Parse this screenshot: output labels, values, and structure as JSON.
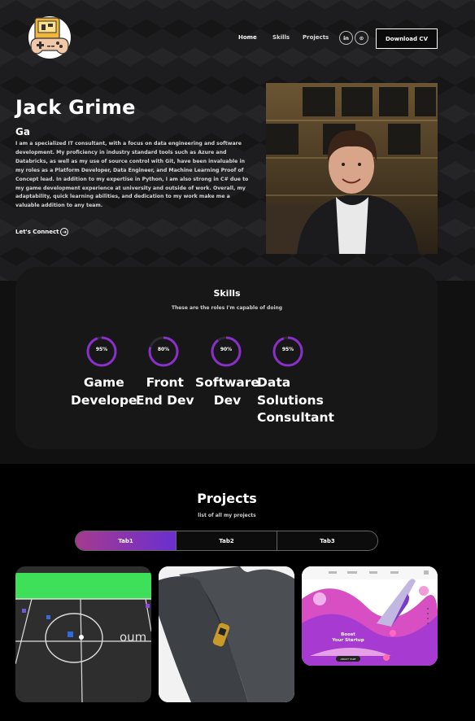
{
  "nav": {
    "links": [
      "Home",
      "Skills",
      "Projects"
    ],
    "social": [
      "in",
      "⊙"
    ],
    "cv_button": "Download CV"
  },
  "hero": {
    "name": "Jack Grime",
    "role": "Ga",
    "bio": "I am a specialized IT consultant, with a focus on data engineering and software development. My proficiency in industry standard tools such as Azure and Databricks, as well as my use of source control with Git, have been invaluable in my roles as a Platform Developer, Data Engineer, and Machine Learning Proof of Concept lead. In addition to my expertise in Python, I am also strong in C# due to my game development experience at university and outside of work. Overall, my adaptability, quick learning abilities, and dedication to my work make me a valuable addition to any team.",
    "connect_label": "Let's Connect"
  },
  "skills": {
    "title": "Skills",
    "subtitle": "These are the roles I'm capable of doing",
    "items": [
      {
        "percent": "95%",
        "value": 95,
        "name": "Game\nDevelope"
      },
      {
        "percent": "80%",
        "value": 80,
        "name": "Front\nEnd Dev"
      },
      {
        "percent": "90%",
        "value": 90,
        "name": "Software\nDev"
      },
      {
        "percent": "95%",
        "value": 95,
        "name": "Data\nSolutions\nConsultant"
      }
    ]
  },
  "projects": {
    "title": "Projects",
    "subtitle": "list of all my projects",
    "tabs": [
      "Tab1",
      "Tab2",
      "Tab3"
    ],
    "active_tab": 0,
    "card3": {
      "heading1": "Boost",
      "heading2": "Your Startup",
      "button": "ABOUT TAKE"
    }
  },
  "colors": {
    "accent_start": "#a63a8e",
    "accent_end": "#6a2fd0",
    "ring": "#8a2fc9"
  }
}
